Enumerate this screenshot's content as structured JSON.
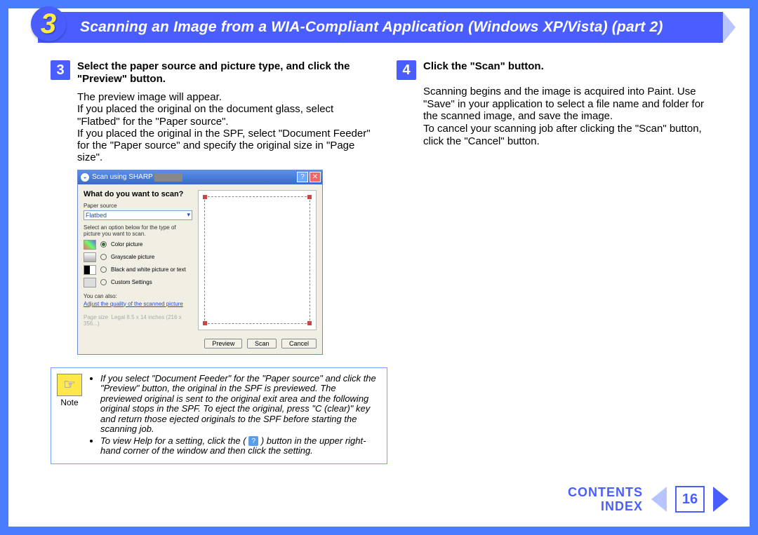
{
  "banner": {
    "section_number": "3",
    "title": "Scanning an Image from a WIA-Compliant Application (Windows XP/Vista) (part 2)"
  },
  "steps": [
    {
      "num": "3",
      "head": "Select the paper source and picture type, and click the \"Preview\" button.",
      "body": "The preview image will appear.\nIf you placed the original on the document glass, select \"Flatbed\" for the \"Paper source\".\nIf you placed the original in the SPF, select \"Document Feeder\" for the \"Paper source\" and specify the original size in \"Page size\"."
    },
    {
      "num": "4",
      "head": "Click the \"Scan\" button.",
      "body": "Scanning begins and the image is acquired into Paint. Use \"Save\" in your application to select a file name and folder for the scanned image, and save the image.\nTo cancel your scanning job after clicking the \"Scan\" button, click the \"Cancel\" button."
    }
  ],
  "dialog": {
    "title_prefix": "Scan using SHARP",
    "question": "What do you want to scan?",
    "paper_source_label": "Paper source",
    "paper_source_value": "Flatbed",
    "subtext": "Select an option below for the type of picture you want to scan.",
    "options": [
      "Color picture",
      "Grayscale picture",
      "Black and white picture or text",
      "Custom Settings"
    ],
    "you_can_also": "You can also:",
    "link": "Adjust the quality of the scanned picture",
    "page_size_label": "Page size",
    "page_size_value": "Legal 8.5 x 14 inches (216 x 356...)",
    "buttons": {
      "preview": "Preview",
      "scan": "Scan",
      "cancel": "Cancel"
    }
  },
  "note": {
    "label": "Note",
    "items": [
      "If you select \"Document Feeder\" for the \"Paper source\" and click the \"Preview\" button, the original in the SPF is previewed. The previewed original is sent to the original exit area and the following original stops in the SPF. To eject the original, press \"C (clear)\" key and return those ejected originals to the SPF before starting the scanning job.",
      "To view Help for a setting, click the ( ? ) button in the upper right-hand corner of the window and then click the setting."
    ]
  },
  "footer": {
    "contents": "CONTENTS",
    "index": "INDEX",
    "page": "16"
  }
}
